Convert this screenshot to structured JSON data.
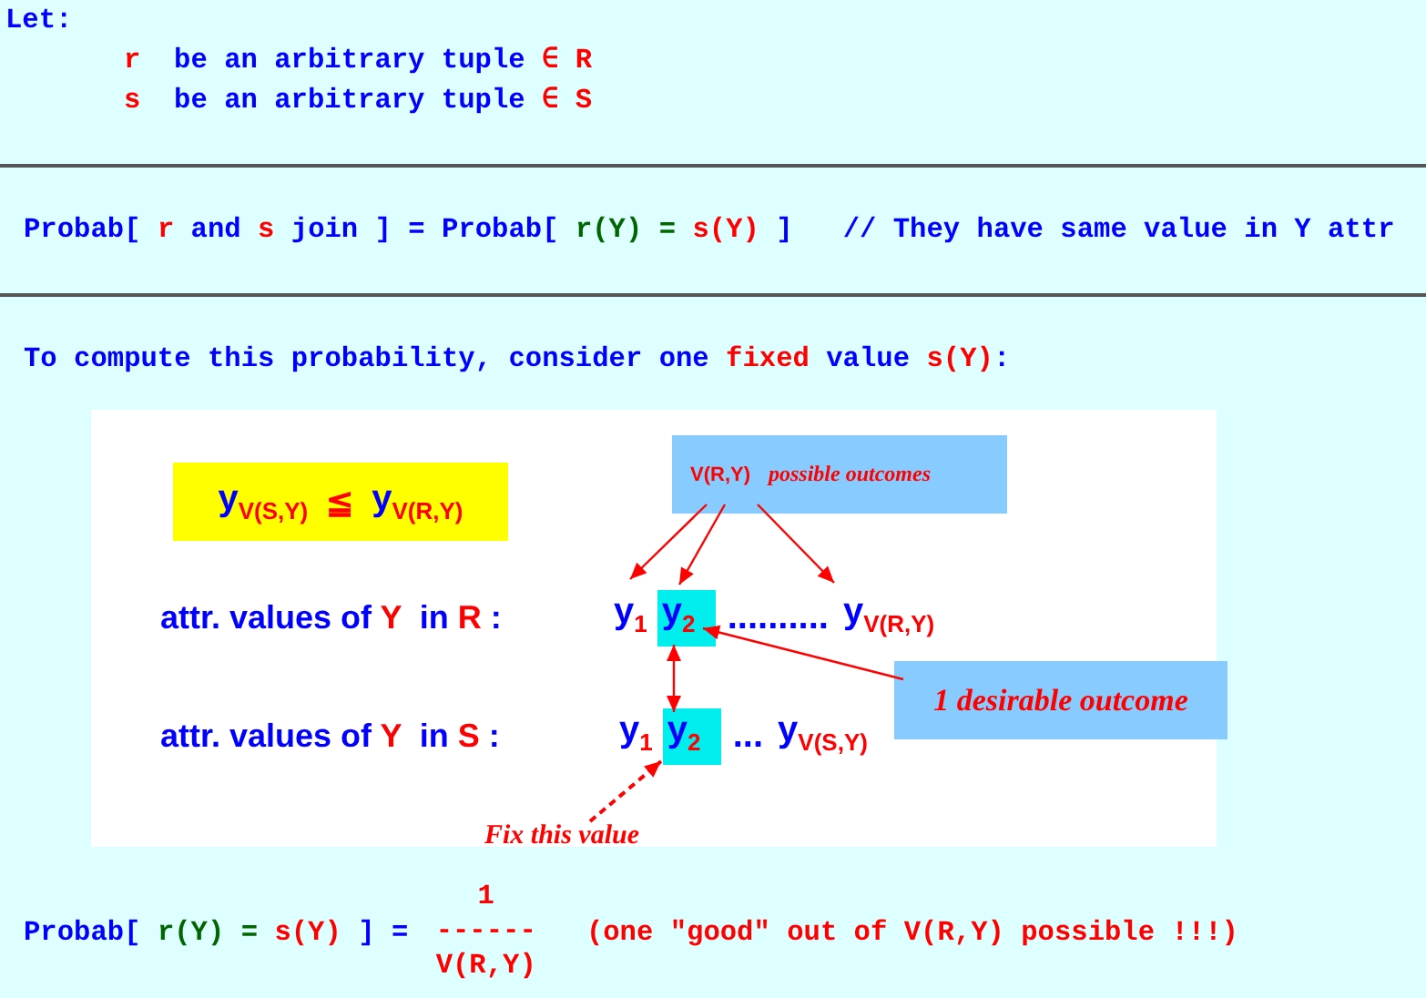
{
  "let_block": {
    "heading": "Let:",
    "items": [
      {
        "parts": [
          {
            "text": "r",
            "color": "#ff0000"
          },
          {
            "text": "  be an arbitrary tuple ",
            "color": "#0000ff"
          },
          {
            "text": "∈ R",
            "color": "#ff0000"
          }
        ]
      },
      {
        "parts": [
          {
            "text": "s",
            "color": "#ff0000"
          },
          {
            "text": "  be an arbitrary tuple ",
            "color": "#0000ff"
          },
          {
            "text": "∈ S",
            "color": "#ff0000"
          }
        ]
      }
    ]
  },
  "join_line": {
    "parts": [
      {
        "text": "Probab[ ",
        "color": "#0000ff"
      },
      {
        "text": "r",
        "color": "#ff0000"
      },
      {
        "text": " and ",
        "color": "#0000ff"
      },
      {
        "text": "s",
        "color": "#ff0000"
      },
      {
        "text": " join ] = Probab[ ",
        "color": "#0000ff"
      },
      {
        "text": "r(Y) = ",
        "color": "#006600"
      },
      {
        "text": "s(Y)",
        "color": "#ff0000"
      },
      {
        "text": " ]",
        "color": "#0000ff"
      }
    ],
    "comment": "// They have same value in Y attr"
  },
  "compute_line": {
    "parts": [
      {
        "text": "To compute this probability, consider one ",
        "color": "#0000ff"
      },
      {
        "text": "fixed",
        "color": "#ff0000"
      },
      {
        "text": " value ",
        "color": "#0000ff"
      },
      {
        "text": "s(Y)",
        "color": "#ff0000"
      },
      {
        "text": ":",
        "color": "#0000ff"
      }
    ]
  },
  "diagram": {
    "inequality": {
      "left": "y$_{V(S,Y)}$",
      "relation": "≦",
      "right": "y$_{V(R,Y)}$"
    },
    "outcomes_box": {
      "count": "V(R,Y)",
      "caption": "possible outcomes"
    },
    "rows": [
      {
        "label_parts": [
          {
            "text": "attr. values of ",
            "color": "#0000ff"
          },
          {
            "text": "Y",
            "color": "#ff0000"
          },
          {
            "text": "  in ",
            "color": "#0000ff"
          },
          {
            "text": "R",
            "color": "#ff0000"
          },
          {
            "text": " :",
            "color": "#0000ff"
          }
        ],
        "values": [
          {
            "text": "y$_{1}$",
            "highlighted": false
          },
          {
            "text": "y$_{2}$",
            "highlighted": true
          },
          {
            "text": "..........",
            "highlighted": false
          },
          {
            "text": "y$_{V(R,Y)}$",
            "highlighted": false
          }
        ]
      },
      {
        "label_parts": [
          {
            "text": "attr. values of ",
            "color": "#0000ff"
          },
          {
            "text": "Y",
            "color": "#ff0000"
          },
          {
            "text": "  in ",
            "color": "#0000ff"
          },
          {
            "text": "S",
            "color": "#ff0000"
          },
          {
            "text": " :",
            "color": "#0000ff"
          }
        ],
        "values": [
          {
            "text": "y$_{1}$",
            "highlighted": false
          },
          {
            "text": "y$_{2}$",
            "highlighted": true
          },
          {
            "text": "...",
            "highlighted": false
          },
          {
            "text": "y$_{V(S,Y)}$",
            "highlighted": false
          }
        ]
      }
    ],
    "desirable_box": "1 desirable outcome",
    "fix_label": "Fix this value"
  },
  "formula": {
    "lhs_parts": [
      {
        "text": "Probab[ ",
        "color": "#0000ff"
      },
      {
        "text": "r(Y) = ",
        "color": "#006600"
      },
      {
        "text": "s(Y)",
        "color": "#ff0000"
      },
      {
        "text": " ] = ",
        "color": "#0000ff"
      }
    ],
    "numerator": "1",
    "bar": "------",
    "denominator": "V(R,Y)",
    "note": "(one \"good\" out of V(R,Y) possible !!!)"
  }
}
